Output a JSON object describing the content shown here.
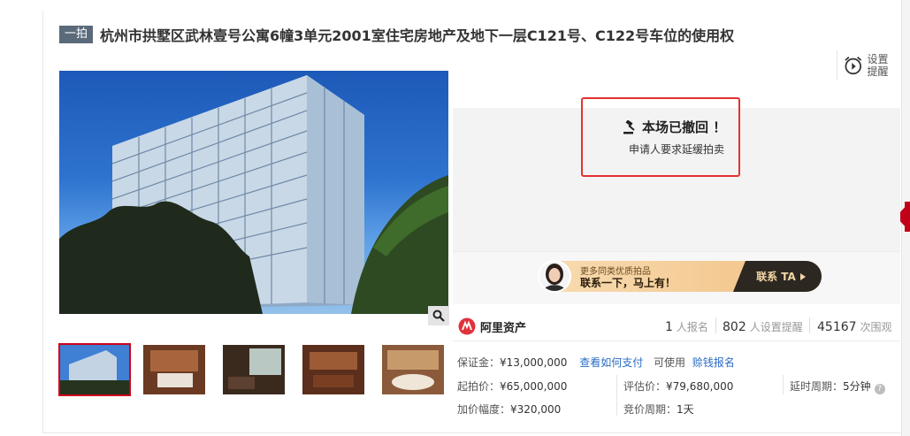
{
  "header": {
    "tag": "一拍",
    "title": "杭州市拱墅区武林壹号公寓6幢3单元2001室住宅房地产及地下一层C121号、C122号车位的使用权"
  },
  "remind": {
    "label": "设置提醒"
  },
  "status": {
    "title": "本场已撤回 ！",
    "subtitle": "申请人要求延缓拍卖"
  },
  "banner": {
    "small": "更多同类优质拍品",
    "big": "联系一下，马上有！",
    "button": "联系 TA"
  },
  "brand": {
    "name": "阿里资产"
  },
  "stats": {
    "signup_count": "1",
    "signup_label": "人报名",
    "remind_count": "802",
    "remind_label": "人设置提醒",
    "view_count": "45167",
    "view_label": "次围观"
  },
  "details": {
    "deposit_label": "保证金：",
    "deposit_value": "¥13,000,000",
    "pay_link": "查看如何支付",
    "usable_text": "可使用",
    "credit_link": "赊钱报名",
    "start_price_label": "起拍价：",
    "start_price_value": "¥65,000,000",
    "valuation_label": "评估价：",
    "valuation_value": "¥79,680,000",
    "delay_label": "延时周期：",
    "delay_value": "5分钟",
    "increment_label": "加价幅度：",
    "increment_value": "¥320,000",
    "cycle_label": "竞价周期：",
    "cycle_value": "1天"
  },
  "colors": {
    "accent_red": "#e53030",
    "link_blue": "#2b6cc4",
    "tag_gray": "#5a6a7a",
    "banner_dark": "#2d2722"
  }
}
